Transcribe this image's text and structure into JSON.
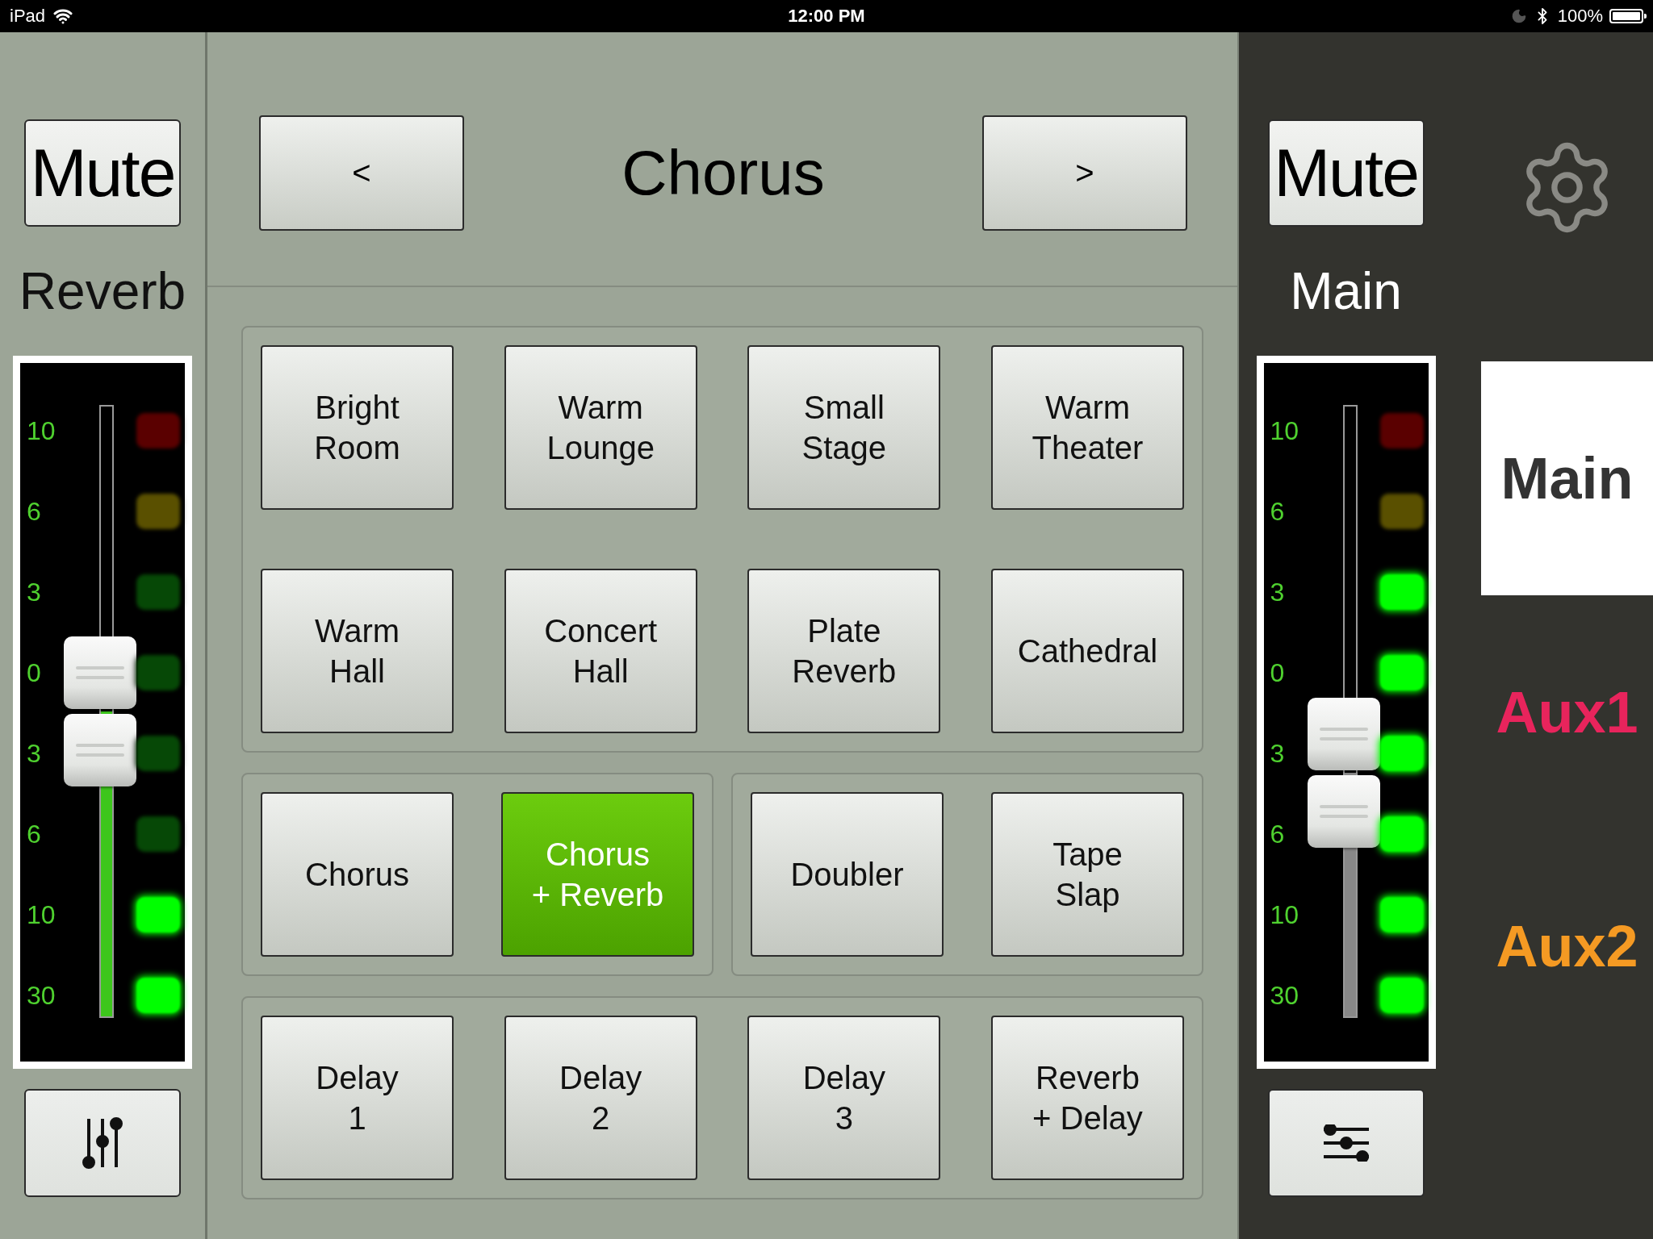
{
  "status_bar": {
    "device": "iPad",
    "time": "12:00 PM",
    "battery": "100%"
  },
  "left_strip": {
    "mute": "Mute",
    "name": "Reverb",
    "fader": {
      "level": 0.5,
      "kind": "green"
    },
    "scale": [
      "10",
      "6",
      "3",
      "0",
      "3",
      "6",
      "10",
      "30"
    ],
    "leds": [
      {
        "color": "#5a0000",
        "on": false
      },
      {
        "color": "#5a5000",
        "on": false
      },
      {
        "color": "#064806",
        "on": false
      },
      {
        "color": "#064806",
        "on": false
      },
      {
        "color": "#064806",
        "on": false
      },
      {
        "color": "#064806",
        "on": false
      },
      {
        "color": "#00ff00",
        "on": true
      },
      {
        "color": "#00ff00",
        "on": true
      }
    ],
    "bottom_button": {
      "kind": "mixer"
    }
  },
  "effect": {
    "title": "Chorus",
    "prev": "<",
    "next": ">"
  },
  "preset_groups": [
    {
      "presets": [
        {
          "label": "Bright\nRoom",
          "selected": false
        },
        {
          "label": "Warm\nLounge",
          "selected": false
        },
        {
          "label": "Small\nStage",
          "selected": false
        },
        {
          "label": "Warm\nTheater",
          "selected": false
        },
        {
          "label": "Warm\nHall",
          "selected": false
        },
        {
          "label": "Concert\nHall",
          "selected": false
        },
        {
          "label": "Plate\nReverb",
          "selected": false
        },
        {
          "label": "Cathedral",
          "selected": false
        }
      ]
    },
    {
      "presets": [
        {
          "label": "Chorus",
          "selected": false
        },
        {
          "label": "Chorus\n+ Reverb",
          "selected": true
        }
      ]
    },
    {
      "presets": [
        {
          "label": "Doubler",
          "selected": false
        },
        {
          "label": "Tape\nSlap",
          "selected": false
        }
      ]
    },
    {
      "presets": [
        {
          "label": "Delay\n1",
          "selected": false
        },
        {
          "label": "Delay\n2",
          "selected": false
        },
        {
          "label": "Delay\n3",
          "selected": false
        },
        {
          "label": "Reverb\n+ Delay",
          "selected": false
        }
      ]
    }
  ],
  "right_strip": {
    "mute": "Mute",
    "name": "Main",
    "fader": {
      "level": 0.4,
      "kind": "grey"
    },
    "scale": [
      "10",
      "6",
      "3",
      "0",
      "3",
      "6",
      "10",
      "30"
    ],
    "leds": [
      {
        "color": "#5a0000",
        "on": false
      },
      {
        "color": "#5a5000",
        "on": false
      },
      {
        "color": "#00ff00",
        "on": true
      },
      {
        "color": "#00ff00",
        "on": true
      },
      {
        "color": "#00ff00",
        "on": true
      },
      {
        "color": "#00ff00",
        "on": true
      },
      {
        "color": "#00ff00",
        "on": true
      },
      {
        "color": "#00ff00",
        "on": true
      }
    ],
    "bottom_button": {
      "kind": "eq"
    }
  },
  "buses": [
    {
      "label": "Main",
      "color": "#333333",
      "selected": true
    },
    {
      "label": "Aux1",
      "color": "#e8245c",
      "selected": false
    },
    {
      "label": "Aux2",
      "color": "#f59a23",
      "selected": false
    }
  ]
}
